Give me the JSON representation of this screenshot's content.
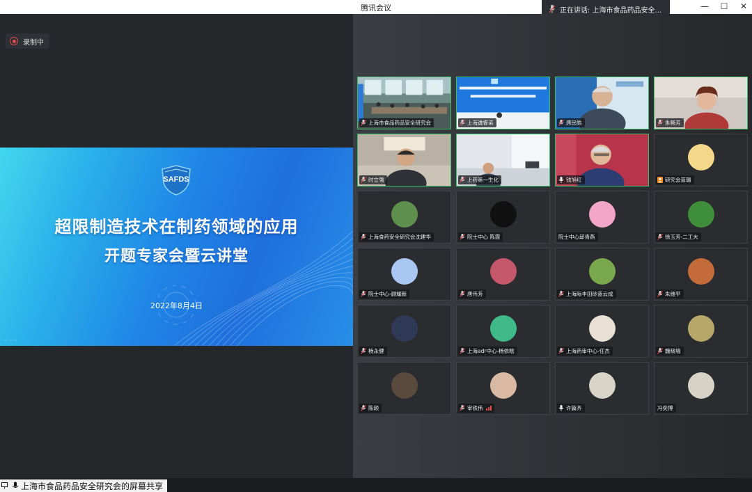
{
  "window": {
    "title": "腾讯会议",
    "speaking": "正在讲话: 上海市食品药品安全...",
    "controls": [
      "—",
      "☐",
      "✕"
    ]
  },
  "recording": {
    "label": "录制中"
  },
  "slide": {
    "logo": "SAFDS",
    "title_line1": "超限制造技术在制药领域的应用",
    "title_line2": "开题专家会暨云讲堂",
    "date": "2022年8月4日",
    "footer": "~ ~ ~"
  },
  "share_bar": {
    "label": "上海市食品药品安全研究会的屏幕共享"
  },
  "participants": [
    {
      "name": "上海市食品药品安全研究会",
      "icon": "muted-mic-icon",
      "kind": "video",
      "scene": "room"
    },
    {
      "name": "上海谵睿诺",
      "icon": "muted-mic-icon",
      "kind": "video",
      "scene": "screen"
    },
    {
      "name": "唐民皓",
      "icon": "muted-mic-icon",
      "kind": "video",
      "scene": "man-blue"
    },
    {
      "name": "朱畅芳",
      "icon": "muted-mic-icon",
      "kind": "video",
      "scene": "woman"
    },
    {
      "name": "时立强",
      "icon": "muted-mic-icon",
      "kind": "video",
      "scene": "man-office"
    },
    {
      "name": "上药第一生化",
      "icon": "muted-mic-icon",
      "kind": "video",
      "scene": "man-white"
    },
    {
      "name": "钱旭红",
      "icon": "mic-icon",
      "kind": "video",
      "scene": "man-red"
    },
    {
      "name": "研究会蓝璐",
      "icon": "user-icon",
      "kind": "avatar",
      "color": "#f5d78a"
    },
    {
      "name": "上海食药安全研究会沈建华",
      "icon": "muted-mic-icon",
      "kind": "avatar",
      "color": "#5f8f4d"
    },
    {
      "name": "院士中心 陈霞",
      "icon": "muted-mic-icon",
      "kind": "avatar",
      "color": "#111111"
    },
    {
      "name": "院士中心邱青燕",
      "icon": "",
      "kind": "avatar",
      "color": "#f4a6c8"
    },
    {
      "name": "徐玉芳-二工大",
      "icon": "muted-mic-icon",
      "kind": "avatar",
      "color": "#3f8f3a"
    },
    {
      "name": "院士中心-顾耀新",
      "icon": "muted-mic-icon",
      "kind": "avatar",
      "color": "#a9c7f2"
    },
    {
      "name": "唐伟芳",
      "icon": "muted-mic-icon",
      "kind": "avatar",
      "color": "#c4586a"
    },
    {
      "name": "上海际丰田砂蓝云成",
      "icon": "muted-mic-icon",
      "kind": "avatar",
      "color": "#7aa84c"
    },
    {
      "name": "朱维平",
      "icon": "muted-mic-icon",
      "kind": "avatar",
      "color": "#c46b3a"
    },
    {
      "name": "杨永健",
      "icon": "muted-mic-icon",
      "kind": "avatar",
      "color": "#2f3b56"
    },
    {
      "name": "上海adr中心-杨依晗",
      "icon": "muted-mic-icon",
      "kind": "avatar",
      "color": "#3fb88a"
    },
    {
      "name": "上海药审中心-任杰",
      "icon": "muted-mic-icon",
      "kind": "avatar",
      "color": "#e8e1d3"
    },
    {
      "name": "魏晓墙",
      "icon": "muted-mic-icon",
      "kind": "avatar",
      "color": "#b7a86a"
    },
    {
      "name": "陈颉",
      "icon": "muted-mic-icon",
      "kind": "avatar",
      "color": "#5a4a3e"
    },
    {
      "name": "宰铁伟",
      "icon": "muted-mic-icon",
      "kind": "avatar",
      "color": "#d9b9a4",
      "signal": true
    },
    {
      "name": "许篇齐",
      "icon": "mic-icon",
      "kind": "avatar",
      "color": "#d8d4c8"
    },
    {
      "name": "冯奕博",
      "icon": "",
      "kind": "avatar",
      "color": "#d7d2c6"
    }
  ]
}
